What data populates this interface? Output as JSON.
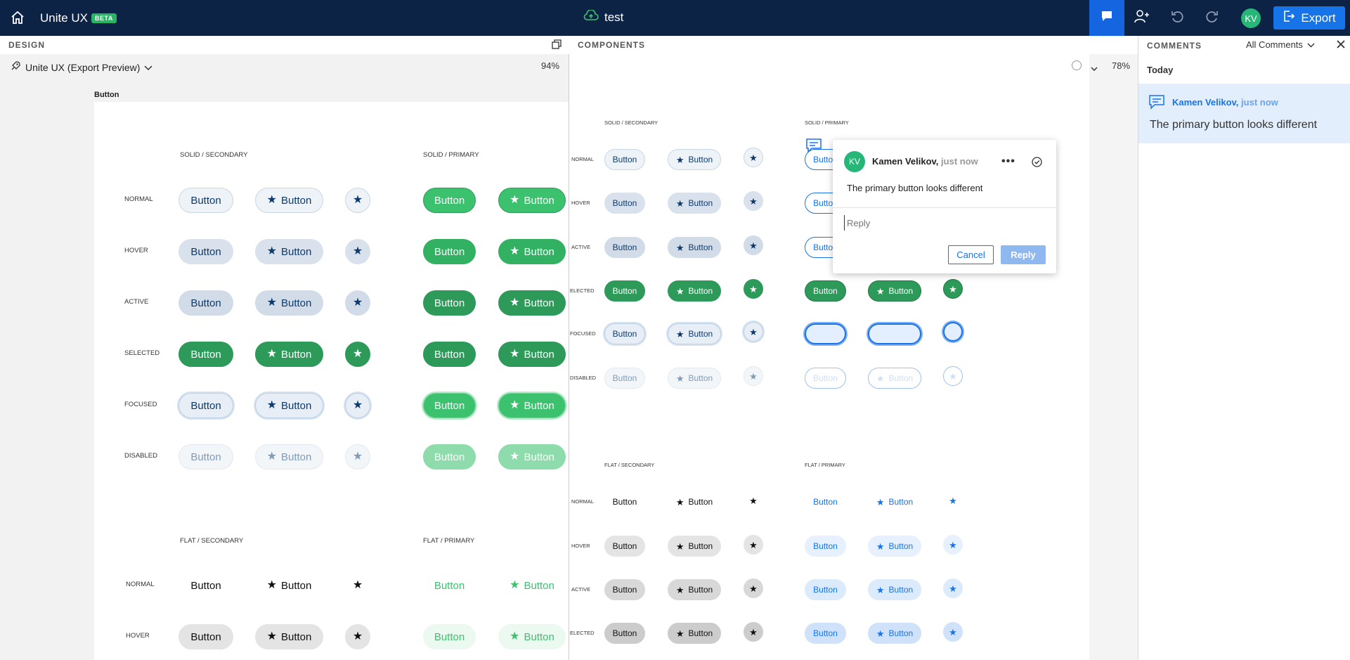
{
  "app": {
    "title": "Unite UX",
    "badge": "BETA",
    "project": "test",
    "export_label": "Export",
    "user_initials": "KV"
  },
  "design": {
    "header": "DESIGN",
    "file_name": "Unite UX (Export Preview)",
    "zoom": "94%",
    "frame_label": "Button"
  },
  "components": {
    "header": "COMPONENTS",
    "zoom": "78%"
  },
  "groups": {
    "solid_secondary": "SOLID / SECONDARY",
    "solid_primary": "SOLID / PRIMARY",
    "flat_secondary": "FLAT / SECONDARY",
    "flat_primary": "FLAT / PRIMARY"
  },
  "states": {
    "normal": "NORMAL",
    "hover": "HOVER",
    "active": "ACTIVE",
    "selected": "SELECTED",
    "focused": "FOCUSED",
    "disabled": "DISABLED"
  },
  "comp_states_cut": {
    "selected": "ELECTED",
    "focused": "FOCUSED",
    "disabled": "DISABLED",
    "selected_flat": "ELECTED"
  },
  "button_label": "Button",
  "comments": {
    "header": "COMMENTS",
    "filter": "All Comments",
    "section": "Today",
    "items": [
      {
        "author": "Kamen Velikov,",
        "time": "just now",
        "text": "The primary button looks different"
      }
    ]
  },
  "popup": {
    "initials": "KV",
    "author": "Kamen Velikov,",
    "time": "just now",
    "text": "The primary button looks different",
    "reply_placeholder": "Reply",
    "cancel_label": "Cancel",
    "reply_label": "Reply"
  },
  "colors": {
    "topbar": "#0c2346",
    "accent": "#1773e8",
    "primary_green": "#2d9a59",
    "primary_green_light": "#3cc26e",
    "secondary_bg": "#e8eef5",
    "flat_primary_text": "#1a73e8"
  }
}
